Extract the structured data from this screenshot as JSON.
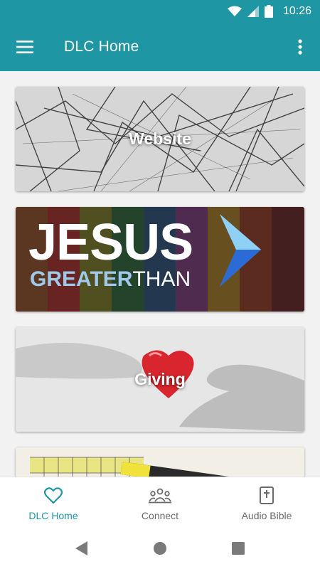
{
  "status": {
    "time": "10:26"
  },
  "app_bar": {
    "title": "DLC Home",
    "menu_icon": "hamburger-menu-icon",
    "more_icon": "more-vert-icon"
  },
  "cards": [
    {
      "label": "Website"
    },
    {
      "title_main": "JESUS",
      "title_sub_a": "GREATER",
      "title_sub_b": "THAN"
    },
    {
      "label": "Giving"
    },
    {
      "label": ""
    }
  ],
  "bottom_nav": {
    "items": [
      {
        "label": "DLC Home",
        "icon": "heart-icon",
        "active": true
      },
      {
        "label": "Connect",
        "icon": "people-icon",
        "active": false
      },
      {
        "label": "Audio Bible",
        "icon": "bible-icon",
        "active": false
      }
    ]
  },
  "colors": {
    "accent": "#1f96a3",
    "inactive": "#6b6b6b"
  }
}
